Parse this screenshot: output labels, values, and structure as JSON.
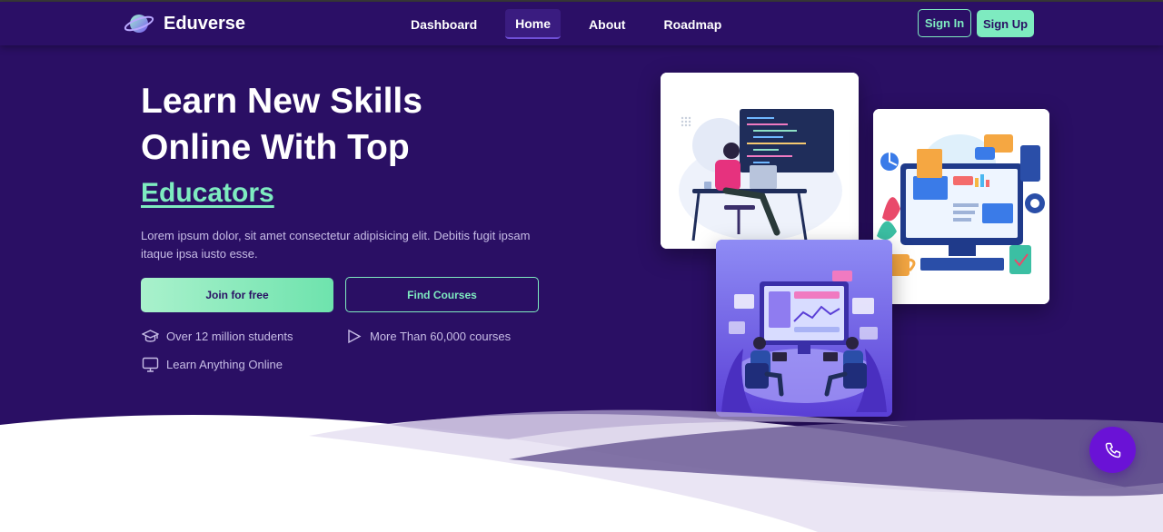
{
  "brand": {
    "name": "Eduverse",
    "logo_icon": "planet-icon"
  },
  "nav": {
    "links": [
      {
        "label": "Dashboard",
        "active": false
      },
      {
        "label": "Home",
        "active": true
      },
      {
        "label": "About",
        "active": false
      },
      {
        "label": "Roadmap",
        "active": false
      }
    ],
    "signin_label": "Sign In",
    "signup_label": "Sign Up"
  },
  "hero": {
    "title": "Learn New Skills Online With Top",
    "accent": "Educators",
    "description": "Lorem ipsum dolor, sit amet consectetur adipisicing elit. Debitis fugit ipsam itaque ipsa iusto esse.",
    "join_label": "Join for free",
    "find_label": "Find Courses",
    "features": [
      {
        "icon": "graduation-cap-icon",
        "text": "Over 12 million students"
      },
      {
        "icon": "play-icon",
        "text": "More Than 60,000 courses"
      },
      {
        "icon": "monitor-icon",
        "text": "Learn Anything Online"
      }
    ]
  },
  "illustrations": [
    {
      "name": "developer-at-desk-illustration"
    },
    {
      "name": "computer-dashboard-illustration"
    },
    {
      "name": "team-analytics-illustration"
    }
  ],
  "contact": {
    "icon": "phone-icon"
  },
  "colors": {
    "background": "#2a0f64",
    "accent": "#7eebc0",
    "call_button": "#6a12d6"
  }
}
